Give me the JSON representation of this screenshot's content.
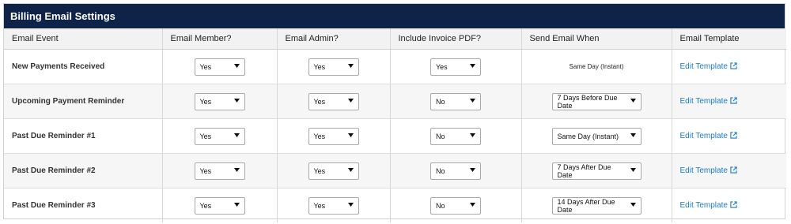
{
  "panel": {
    "title": "Billing Email Settings"
  },
  "columns": [
    "Email Event",
    "Email Member?",
    "Email Admin?",
    "Include Invoice PDF?",
    "Send Email When",
    "Email Template"
  ],
  "rows": [
    {
      "event": "New Payments Received",
      "member": "Yes",
      "admin": "Yes",
      "pdf": "Yes",
      "when": "Same Day (Instant)",
      "when_is_select": false,
      "template": "Edit Template"
    },
    {
      "event": "Upcoming Payment Reminder",
      "member": "Yes",
      "admin": "Yes",
      "pdf": "No",
      "when": "7 Days Before Due Date",
      "when_is_select": true,
      "template": "Edit Template"
    },
    {
      "event": "Past Due Reminder #1",
      "member": "Yes",
      "admin": "Yes",
      "pdf": "No",
      "when": "Same Day (Instant)",
      "when_is_select": true,
      "template": "Edit Template"
    },
    {
      "event": "Past Due Reminder #2",
      "member": "Yes",
      "admin": "Yes",
      "pdf": "No",
      "when": "7 Days After Due Date",
      "when_is_select": true,
      "template": "Edit Template"
    },
    {
      "event": "Past Due Reminder #3",
      "member": "Yes",
      "admin": "Yes",
      "pdf": "No",
      "when": "14 Days After Due Date",
      "when_is_select": true,
      "template": "Edit Template"
    }
  ],
  "icons": {
    "dropdown": "caret-down-icon",
    "external": "external-link-icon"
  },
  "colors": {
    "header_bg": "#0e2347",
    "link": "#1a7ac9"
  }
}
